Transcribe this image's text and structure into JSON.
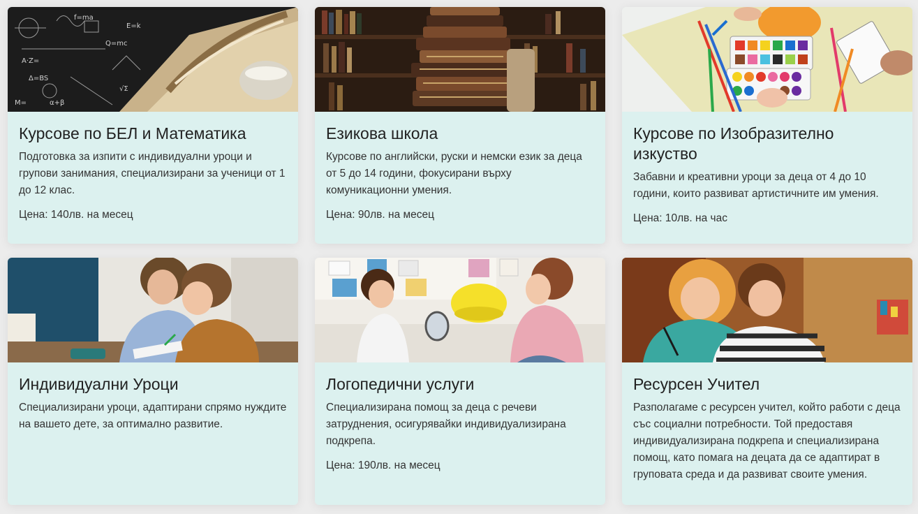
{
  "cards": [
    {
      "title": "Курсове по БЕЛ и Математика",
      "description": "Подготовка за изпити с индивидуални уроци и групови занимания, специализирани за ученици от 1 до 12 клас.",
      "price": "Цена: 140лв. на месец",
      "image_desc": "chalkboard-formulas-quill"
    },
    {
      "title": "Езикова школа",
      "description": "Курсове по английски, руски и немски език за деца от 5 до 14 години, фокусирани върху комуникационни умения.",
      "price": "Цена: 90лв. на месец",
      "image_desc": "stacked-books-library"
    },
    {
      "title": "Курсове по Изобразително изкуство",
      "description": "Забавни и креативни уроци за деца от 4 до 10 години, които развиват артистичните им умения.",
      "price": "Цена: 10лв. на час",
      "image_desc": "watercolor-paints-pencils"
    },
    {
      "title": "Индивидуални Уроци",
      "description": "Специализирани уроци, адаптирани спрямо нуждите на вашето дете, за оптимално развитие.",
      "price": "",
      "image_desc": "tutor-with-boy"
    },
    {
      "title": "Логопедични услуги",
      "description": "Специализирана помощ за деца с речеви затруднения, осигурявайки индивидуализирана подкрепа.",
      "price": "Цена: 190лв. на месец",
      "image_desc": "speech-therapy-mirror"
    },
    {
      "title": "Ресурсен Учител",
      "description": "Разполагаме с ресурсен учител, който работи с деца със социални потребности. Той предоставя индивидуализирана подкрепа и специализирана помощ, като помага на децата да се адаптират в груповата среда и да развиват своите умения.",
      "price": "",
      "image_desc": "teacher-helping-child"
    }
  ]
}
